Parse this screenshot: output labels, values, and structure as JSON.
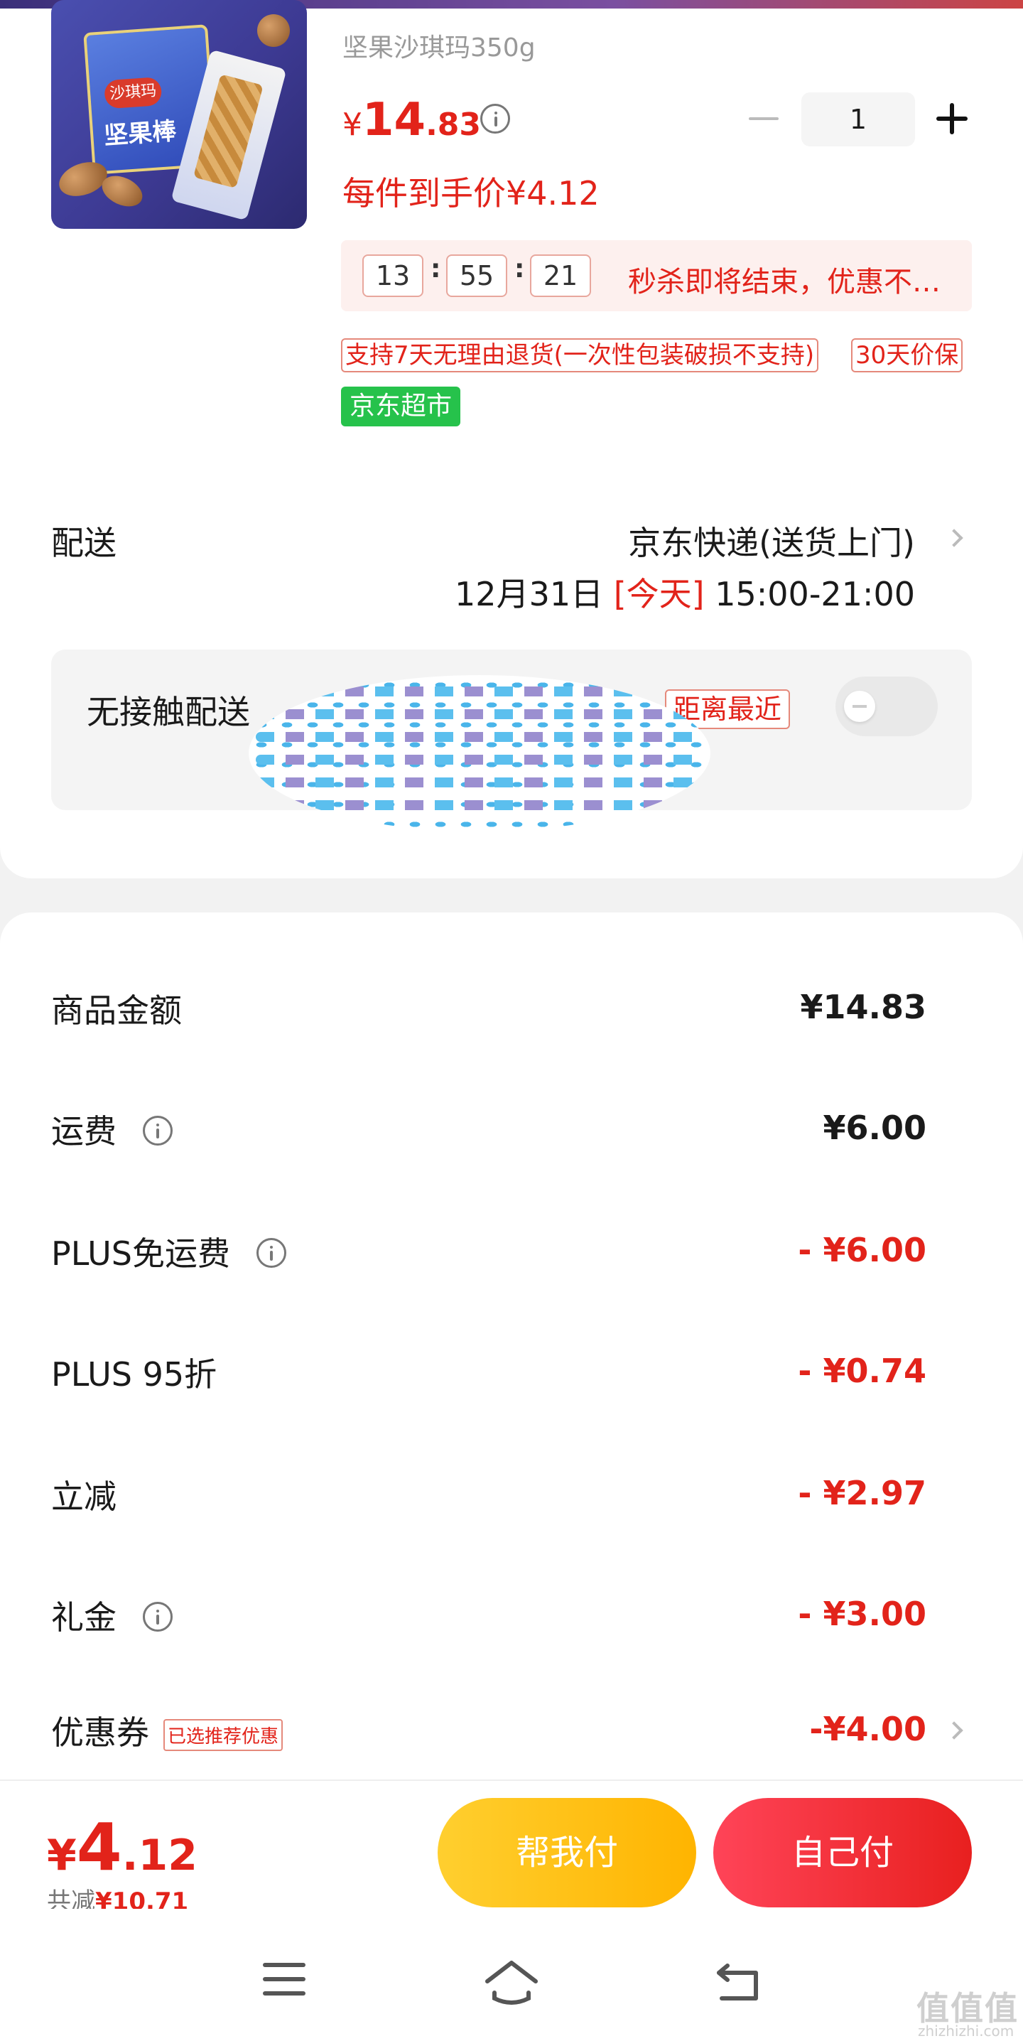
{
  "product": {
    "subtitle": "坚果沙琪玛350g",
    "price_currency": "¥",
    "price_int": "14",
    "price_dec": ".83",
    "quantity": "1",
    "per_item_price": "每件到手价¥4.12",
    "image_logo": "沙琪玛",
    "image_name": "坚果棒"
  },
  "flash_sale": {
    "hours": "13",
    "minutes": "55",
    "seconds": "21",
    "message": "秒杀即将结束，优惠不…"
  },
  "service_tags": [
    "支持7天无理由退货(一次性包装破损不支持)",
    "30天价保"
  ],
  "store_badge": "京东超市",
  "shipping": {
    "label": "配送",
    "method": "京东快递(送货上门)",
    "date": "12月31日 ",
    "today": "[今天]",
    "window": " 15:00-21:00"
  },
  "contactless": {
    "label": "无接触配送",
    "near_tag": "距离最近",
    "enabled": false
  },
  "price_details": [
    {
      "label": "商品金额",
      "value": "¥14.83",
      "red": false,
      "info": false
    },
    {
      "label": "运费",
      "value": "¥6.00",
      "red": false,
      "info": true
    },
    {
      "label": "PLUS免运费",
      "value": "- ¥6.00",
      "red": true,
      "info": true
    },
    {
      "label": "PLUS 95折",
      "value": "- ¥0.74",
      "red": true,
      "info": false
    },
    {
      "label": "立减",
      "value": "- ¥2.97",
      "red": true,
      "info": false
    },
    {
      "label": "礼金",
      "value": "- ¥3.00",
      "red": true,
      "info": true
    }
  ],
  "coupon": {
    "label": "优惠券",
    "tag": "已选推荐优惠",
    "value": "-¥4.00"
  },
  "footer": {
    "currency": "¥",
    "total_int": "4",
    "total_dec": ".12",
    "saved_label": "共减",
    "saved_amount": "¥10.71",
    "help_pay": "帮我付",
    "self_pay": "自己付"
  },
  "colors": {
    "accent_red": "#e2231a",
    "help_button": "#ffb400",
    "self_button": "#e8201f",
    "store_green": "#26c24b"
  },
  "watermark": {
    "main": "值值值",
    "sub": "zhizhizhi.com"
  }
}
